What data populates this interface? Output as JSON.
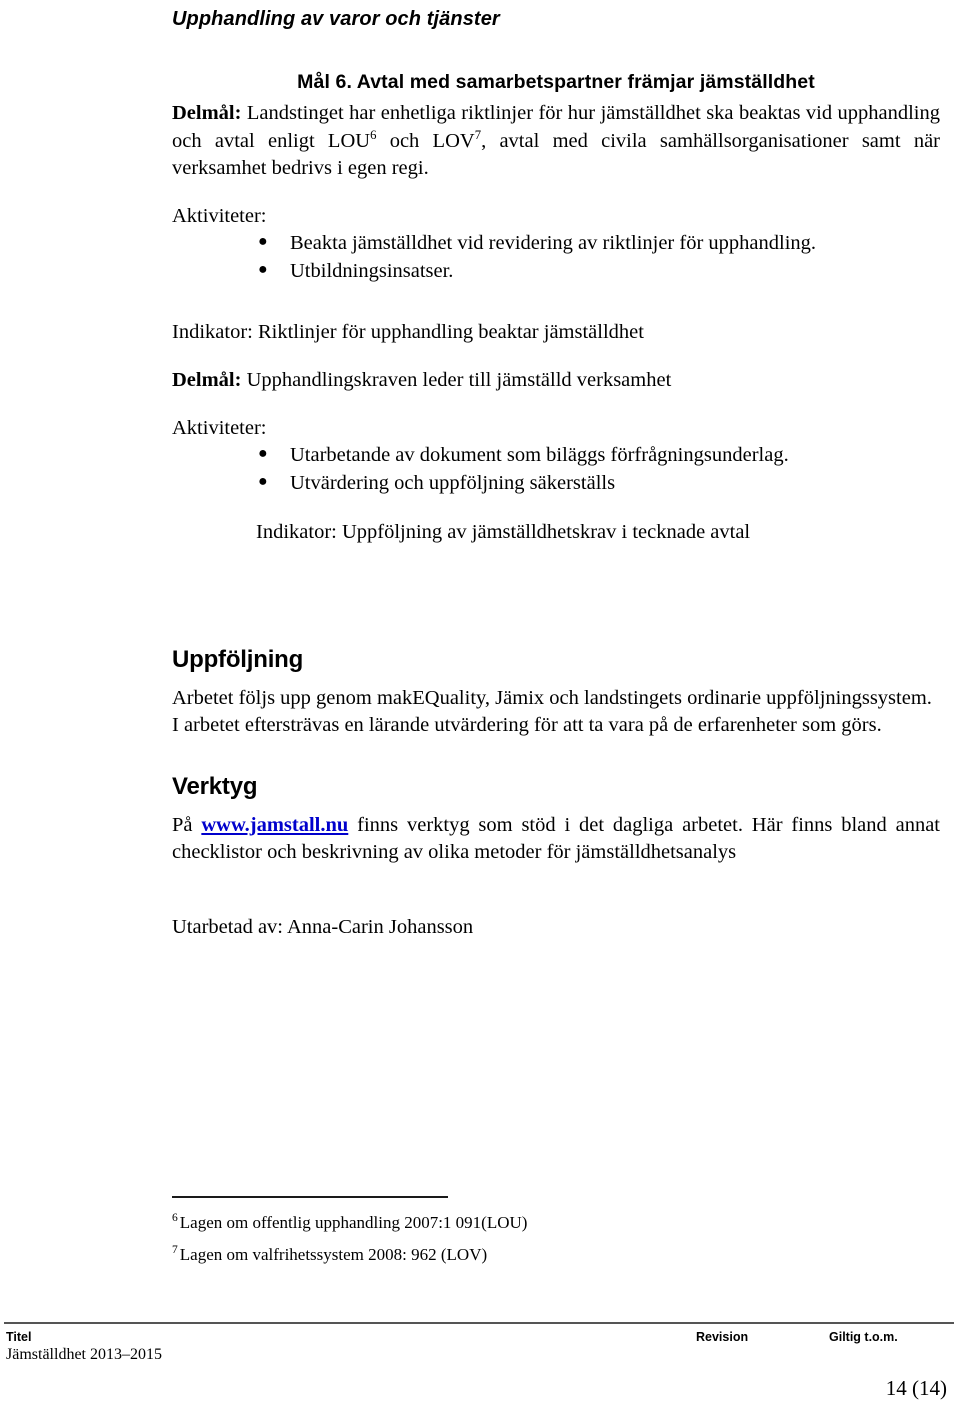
{
  "header": {
    "doc_title": "Upphandling av varor och tjänster"
  },
  "goal": {
    "heading": "Mål 6. Avtal med samarbetspartner främjar jämställdhet"
  },
  "delmal_1": {
    "label": "Delmål:",
    "text_part_1": " Landstinget har enhetliga riktlinjer för hur jämställdhet ska beaktas vid upphandling och avtal enligt LOU",
    "footnote_ref_1": "6",
    "text_part_2": " och LOV",
    "footnote_ref_2": "7",
    "text_part_3": ", avtal med civila samhällsorganisationer samt när verksamhet bedrivs i egen regi.",
    "activities_label": "Aktiviteter:",
    "activities": [
      "Beakta jämställdhet vid revidering av riktlinjer för upphandling.",
      "Utbildningsinsatser."
    ],
    "indicator": "Indikator: Riktlinjer för upphandling beaktar jämställdhet"
  },
  "delmal_2": {
    "label": "Delmål:",
    "text": " Upphandlingskraven leder till jämställd verksamhet",
    "activities_label": "Aktiviteter:",
    "activities": [
      "Utarbetande av dokument som biläggs förfrågningsunderlag.",
      "Utvärdering och uppföljning säkerställs"
    ],
    "indicator": "Indikator: Uppföljning av jämställdhetskrav i tecknade avtal"
  },
  "uppfoljning": {
    "heading": "Uppföljning",
    "paragraph_1": "Arbetet följs upp genom makEQuality, Jämix och landstingets ordinarie uppföljningssystem.",
    "paragraph_2": "I arbetet eftersträvas en lärande utvärdering för att ta vara på de erfarenheter som görs."
  },
  "verktyg": {
    "heading": "Verktyg",
    "text_before_link": "På ",
    "link_text": "www.jamstall.nu",
    "text_after_link": " finns verktyg som stöd i det dagliga arbetet. Här finns bland annat checklistor och beskrivning av olika metoder för jämställdhetsanalys"
  },
  "author": {
    "line": "Utarbetad av: Anna-Carin Johansson"
  },
  "footnotes": [
    {
      "marker": "6",
      "text": "Lagen om offentlig upphandling 2007:1 091(LOU)"
    },
    {
      "marker": "7",
      "text": "Lagen om valfrihetssystem 2008: 962 (LOV)"
    }
  ],
  "footer": {
    "titel_label": "Titel",
    "titel_value": "Jämställdhet 2013–2015",
    "revision_label": "Revision",
    "giltig_label": "Giltig t.o.m.",
    "page_number": "14 (14)"
  },
  "colors": {
    "text": "#000000",
    "link": "#0000cc",
    "rule": "#555555",
    "background": "#ffffff"
  }
}
